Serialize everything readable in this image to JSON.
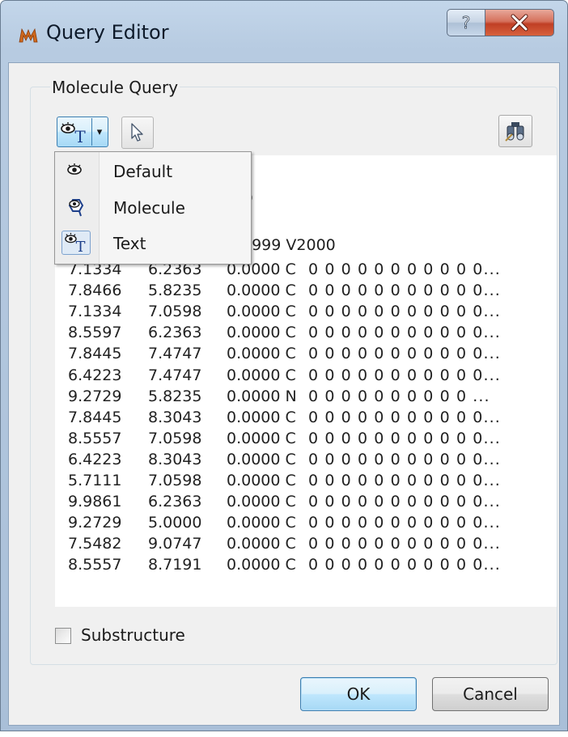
{
  "window": {
    "title": "Query Editor",
    "help_symbol": "?",
    "close_symbol": "✕"
  },
  "group": {
    "label": "Molecule Query"
  },
  "toolbar": {
    "view_combo_icon": "eye-text-icon",
    "view_combo_arrow": "▾",
    "select_icon": "arrow-cursor-icon",
    "search_icon": "binoculars-icon"
  },
  "view_menu": {
    "items": [
      {
        "label": "Default",
        "icon": "eye-icon",
        "checked": false
      },
      {
        "label": "Molecule",
        "icon": "eye-molecule-icon",
        "checked": false
      },
      {
        "label": "Text",
        "icon": "eye-text-icon",
        "checked": true
      }
    ]
  },
  "molfile": {
    "partial_line_1": "D",
    "partial_line_2": "0999 V2000",
    "atoms": [
      {
        "x": "7.1334",
        "y": "6.2363",
        "z": "0.0000 C",
        "rest": "0 0 0 0 0 0 0 0 0 0 0..."
      },
      {
        "x": "7.8466",
        "y": "5.8235",
        "z": "0.0000 C",
        "rest": "0 0 0 0 0 0 0 0 0 0 0..."
      },
      {
        "x": "7.1334",
        "y": "7.0598",
        "z": "0.0000 C",
        "rest": "0 0 0 0 0 0 0 0 0 0 0..."
      },
      {
        "x": "8.5597",
        "y": "6.2363",
        "z": "0.0000 C",
        "rest": "0 0 0 0 0 0 0 0 0 0 0..."
      },
      {
        "x": "7.8445",
        "y": "7.4747",
        "z": "0.0000 C",
        "rest": "0 0 0 0 0 0 0 0 0 0 0..."
      },
      {
        "x": "6.4223",
        "y": "7.4747",
        "z": "0.0000 C",
        "rest": "0 0 0 0 0 0 0 0 0 0 0..."
      },
      {
        "x": "9.2729",
        "y": "5.8235",
        "z": "0.0000 N",
        "rest": "0 0 0 0 0 0 0 0 0 0 ..."
      },
      {
        "x": "7.8445",
        "y": "8.3043",
        "z": "0.0000 C",
        "rest": "0 0 0 0 0 0 0 0 0 0 0..."
      },
      {
        "x": "8.5557",
        "y": "7.0598",
        "z": "0.0000 C",
        "rest": "0 0 0 0 0 0 0 0 0 0 0..."
      },
      {
        "x": "6.4223",
        "y": "8.3043",
        "z": "0.0000 C",
        "rest": "0 0 0 0 0 0 0 0 0 0 0..."
      },
      {
        "x": "5.7111",
        "y": "7.0598",
        "z": "0.0000 C",
        "rest": "0 0 0 0 0 0 0 0 0 0 0..."
      },
      {
        "x": "9.9861",
        "y": "6.2363",
        "z": "0.0000 C",
        "rest": "0 0 0 0 0 0 0 0 0 0 0..."
      },
      {
        "x": "9.2729",
        "y": "5.0000",
        "z": "0.0000 C",
        "rest": "0 0 0 0 0 0 0 0 0 0 0..."
      },
      {
        "x": "7.5482",
        "y": "9.0747",
        "z": "0.0000 C",
        "rest": "0 0 0 0 0 0 0 0 0 0 0..."
      },
      {
        "x": "8.5557",
        "y": "8.7191",
        "z": "0.0000 C",
        "rest": "0 0 0 0 0 0 0 0 0 0 0..."
      }
    ]
  },
  "substructure": {
    "label": "Substructure",
    "checked": false
  },
  "buttons": {
    "ok": "OK",
    "cancel": "Cancel"
  }
}
